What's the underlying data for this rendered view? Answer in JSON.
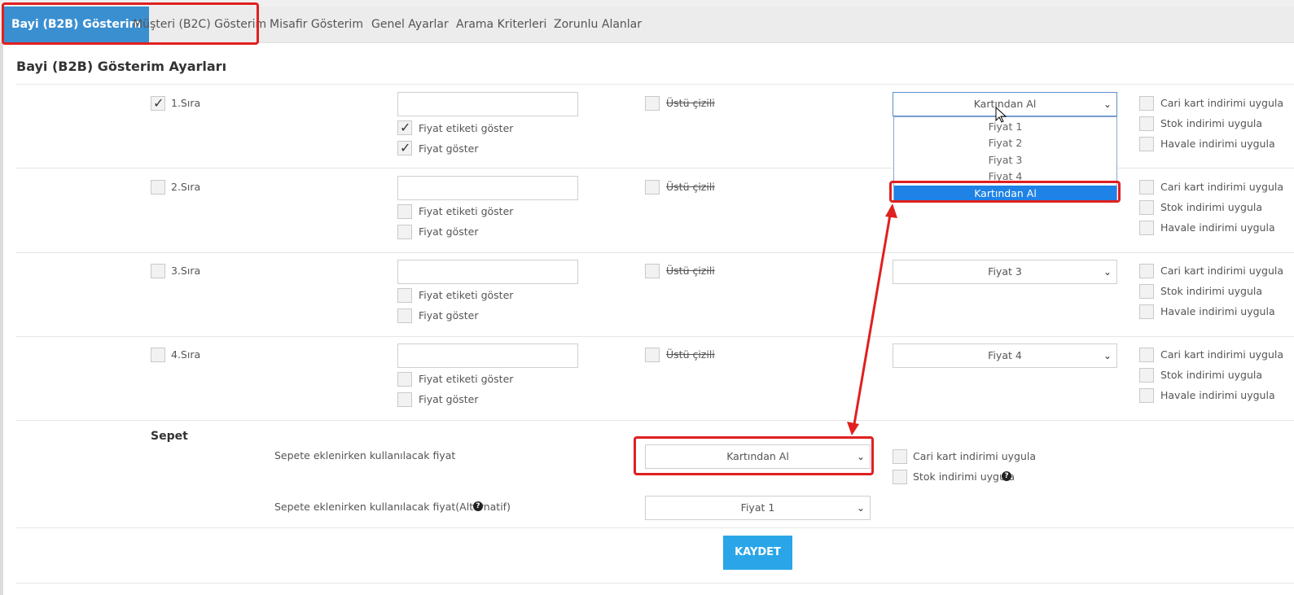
{
  "tabs": [
    {
      "label": "Bayi (B2B) Gösterim"
    },
    {
      "label": "Müşteri (B2C) Gösterim"
    },
    {
      "label": "Misafir Gösterim"
    },
    {
      "label": "Genel Ayarlar"
    },
    {
      "label": "Arama Kriterleri"
    },
    {
      "label": "Zorunlu Alanlar"
    }
  ],
  "page_title": "Bayi (B2B) Gösterim Ayarları",
  "rows": [
    {
      "label": "1.Sıra",
      "price_label_show": "Fiyat etiketi göster",
      "price_show": "Fiyat göster",
      "strike": "Üstü çizili",
      "select": "Kartından Al",
      "discounts": [
        "Cari kart indirimi uygula",
        "Stok indirimi uygula",
        "Havale indirimi uygula"
      ]
    },
    {
      "label": "2.Sıra",
      "price_label_show": "Fiyat etiketi göster",
      "price_show": "Fiyat göster",
      "strike": "Üstü çizili",
      "select": "Kartından Al",
      "discounts": [
        "Cari kart indirimi uygula",
        "Stok indirimi uygula",
        "Havale indirimi uygula"
      ]
    },
    {
      "label": "3.Sıra",
      "price_label_show": "Fiyat etiketi göster",
      "price_show": "Fiyat göster",
      "strike": "Üstü çizili",
      "select": "Fiyat 3",
      "discounts": [
        "Cari kart indirimi uygula",
        "Stok indirimi uygula",
        "Havale indirimi uygula"
      ]
    },
    {
      "label": "4.Sıra",
      "price_label_show": "Fiyat etiketi göster",
      "price_show": "Fiyat göster",
      "strike": "Üstü çizili",
      "select": "Fiyat 4",
      "discounts": [
        "Cari kart indirimi uygula",
        "Stok indirimi uygula",
        "Havale indirimi uygula"
      ]
    }
  ],
  "dropdown_options": [
    "Fiyat 1",
    "Fiyat 2",
    "Fiyat 3",
    "Fiyat 4",
    "Kartından Al"
  ],
  "cart": {
    "title": "Sepet",
    "price_label": "Sepete eklenirken kullanılacak fiyat",
    "price_value": "Kartından Al",
    "alt_label": "Sepete eklenirken kullanılacak fiyat(Alternatif)",
    "alt_value": "Fiyat 1",
    "discount_card": "Cari kart indirimi uygula",
    "discount_stock": "Stok indirimi uygula"
  },
  "save_label": "KAYDET",
  "icons": {
    "help": "question-circle-icon",
    "chevron": "chevron-down-icon",
    "check": "check-icon"
  },
  "colors": {
    "active_tab": "#3a8fd1",
    "save_button": "#2aa6e8",
    "selected_option": "#1e82e6",
    "highlight": "#e02020"
  }
}
